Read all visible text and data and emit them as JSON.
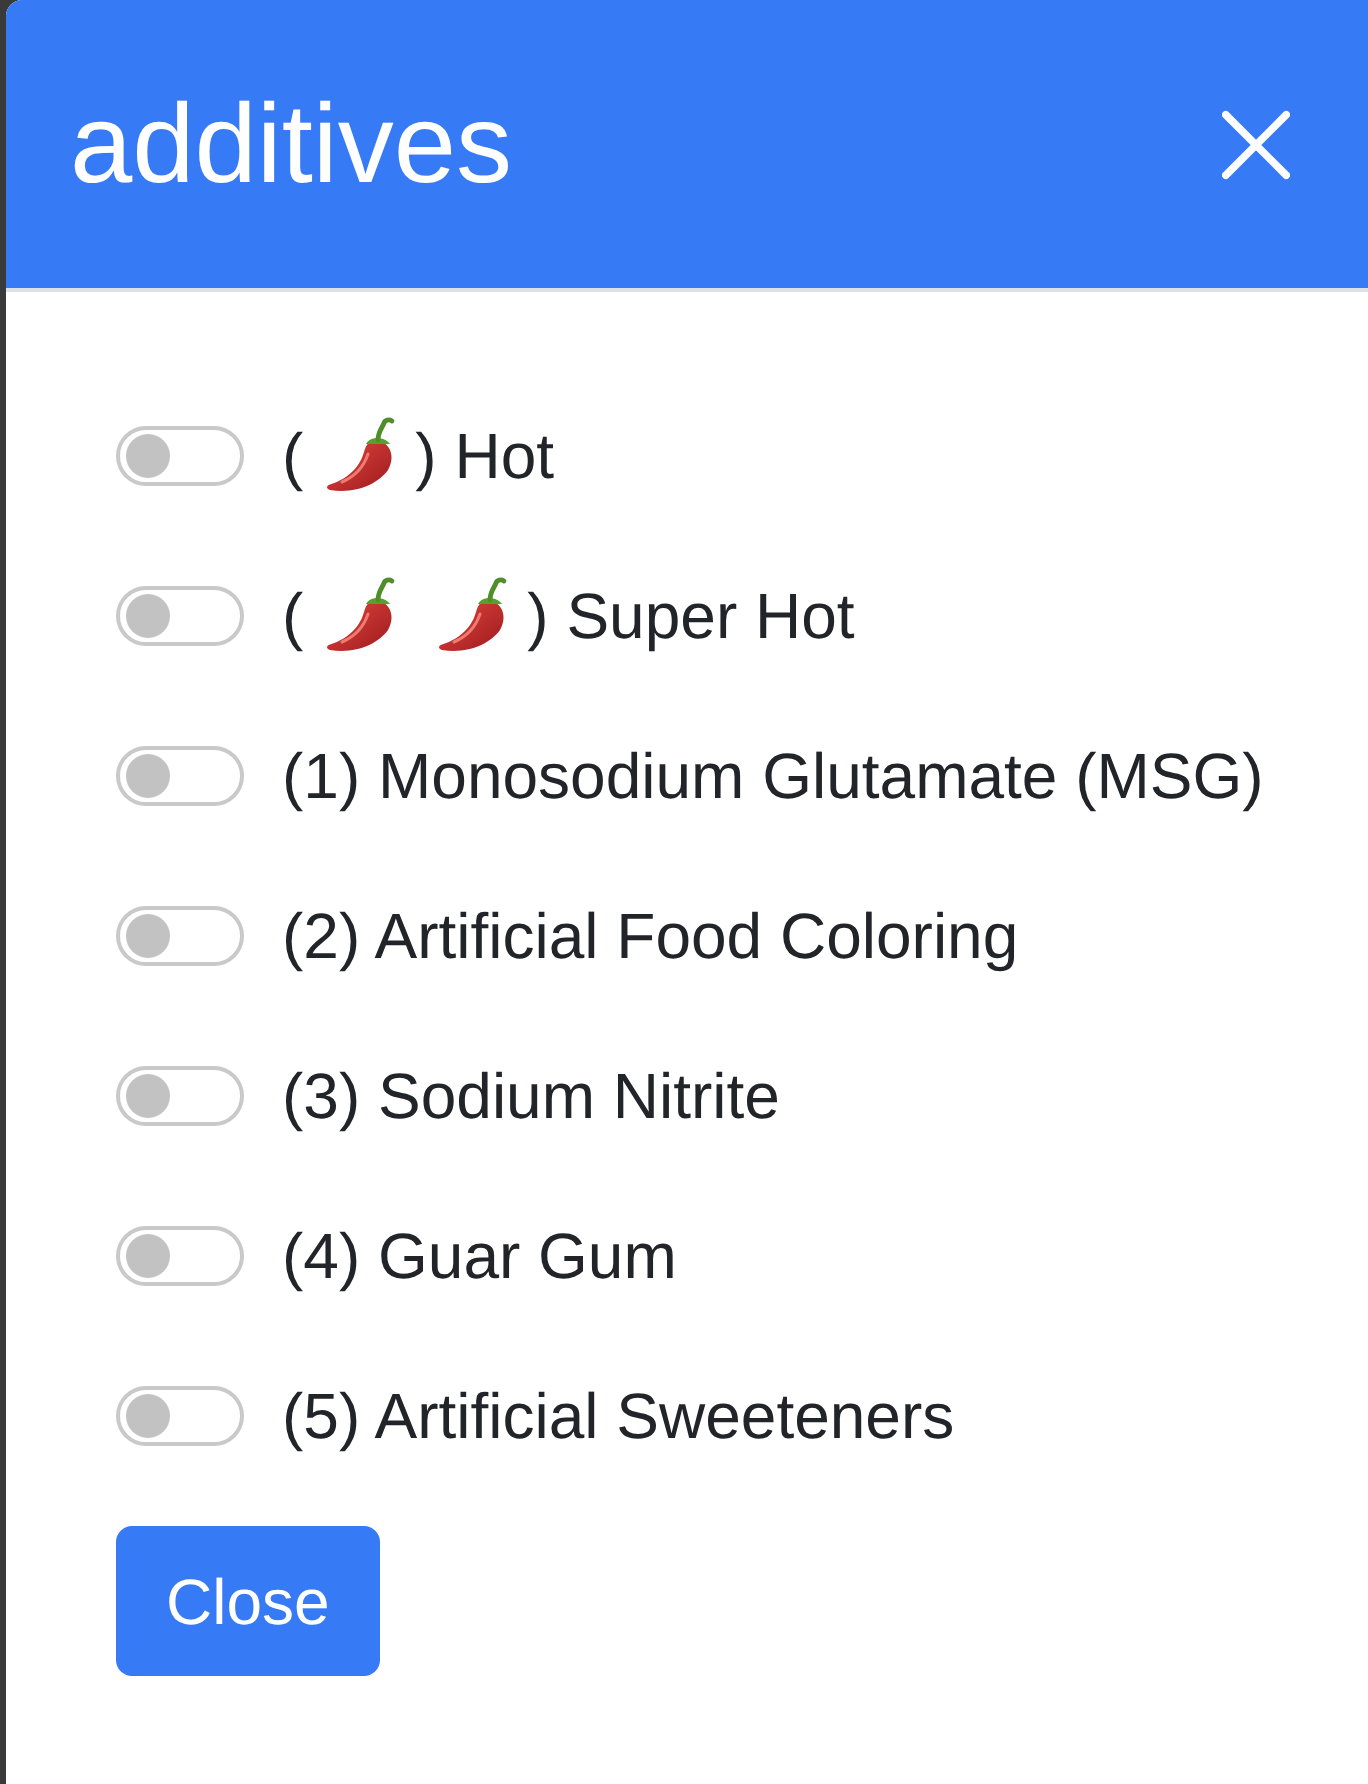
{
  "dialog": {
    "title": "additives"
  },
  "options": [
    {
      "on": false,
      "label": [
        {
          "kind": "text",
          "text": "("
        },
        {
          "kind": "pepper"
        },
        {
          "kind": "text",
          "text": ") Hot"
        }
      ]
    },
    {
      "on": false,
      "label": [
        {
          "kind": "text",
          "text": "("
        },
        {
          "kind": "pepper"
        },
        {
          "kind": "pepper"
        },
        {
          "kind": "text",
          "text": ") Super Hot"
        }
      ]
    },
    {
      "on": false,
      "label": [
        {
          "kind": "text",
          "text": "(1) Monosodium Glutamate (MSG)"
        }
      ]
    },
    {
      "on": false,
      "label": [
        {
          "kind": "text",
          "text": "(2) Artificial Food Coloring"
        }
      ]
    },
    {
      "on": false,
      "label": [
        {
          "kind": "text",
          "text": "(3) Sodium Nitrite"
        }
      ]
    },
    {
      "on": false,
      "label": [
        {
          "kind": "text",
          "text": "(4) Guar Gum"
        }
      ]
    },
    {
      "on": false,
      "label": [
        {
          "kind": "text",
          "text": "(5) Artificial Sweeteners"
        }
      ]
    }
  ],
  "footer": {
    "button": "Close"
  }
}
